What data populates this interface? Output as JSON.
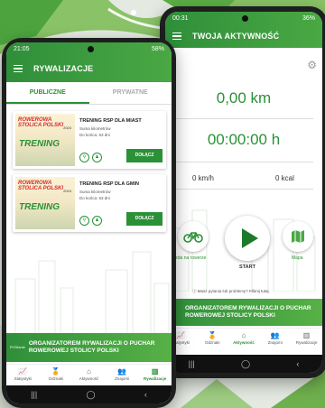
{
  "colors": {
    "brand_green": "#2a9136",
    "dark_green": "#1d7a2b"
  },
  "back_phone": {
    "status_time": "00:31",
    "status_right": "36%",
    "title": "TWOJA AKTYWNOŚĆ",
    "distance": "0,00 km",
    "duration": "00:00:00 h",
    "speed": "0 km/h",
    "calories": "0 kcal",
    "mode_label": "Jazda na rowerze",
    "start_label": "START",
    "map_label": "Mapa",
    "help_text": "Masz pytania lub problemy? Kliknij tutaj.",
    "banner_text": "ORGANIZATOREM RYWALIZACJI O PUCHAR ROWEROWEJ STOLICY POLSKI",
    "tabs": [
      "Statystyki",
      "Odznaki",
      "Aktywność",
      "Znajomi",
      "Rywalizacje"
    ],
    "active_tab_index": 2
  },
  "front_phone": {
    "status_time": "21:05",
    "status_right": "58%",
    "title": "RYWALIZACJE",
    "tab_public": "PUBLICZNE",
    "tab_private": "PRYWATNE",
    "cards": [
      {
        "thumb_top": "ROWEROWA STOLICA POLSKI",
        "thumb_year": "2024",
        "thumb_main": "TRENING",
        "title": "TRENING RSP DLA MIAST",
        "line1": "Suma kilometrów",
        "line2": "Do końca: 63 dni",
        "join": "DOŁĄCZ"
      },
      {
        "thumb_top": "ROWEROWA STOLICA POLSKI",
        "thumb_year": "2024",
        "thumb_main": "TRENING",
        "title": "TRENING RSP DLA GMIN",
        "line1": "Suma kilometrów",
        "line2": "Do końca: 63 dni",
        "join": "DOŁĄCZ"
      }
    ],
    "banner_logo": "RYDlanie",
    "banner_text": "ORGANIZATOREM RYWALIZACJI O PUCHAR ROWEROWEJ STOLICY POLSKI",
    "tabs": [
      "Statystyki",
      "Odznaki",
      "Aktywność",
      "Znajomi",
      "Rywalizacje"
    ],
    "active_tab_index": 4
  },
  "icons": {
    "stats": "chart-line-icon",
    "badges": "medal-icon",
    "activity": "home-icon",
    "friends": "people-icon",
    "competitions": "podium-icon"
  }
}
